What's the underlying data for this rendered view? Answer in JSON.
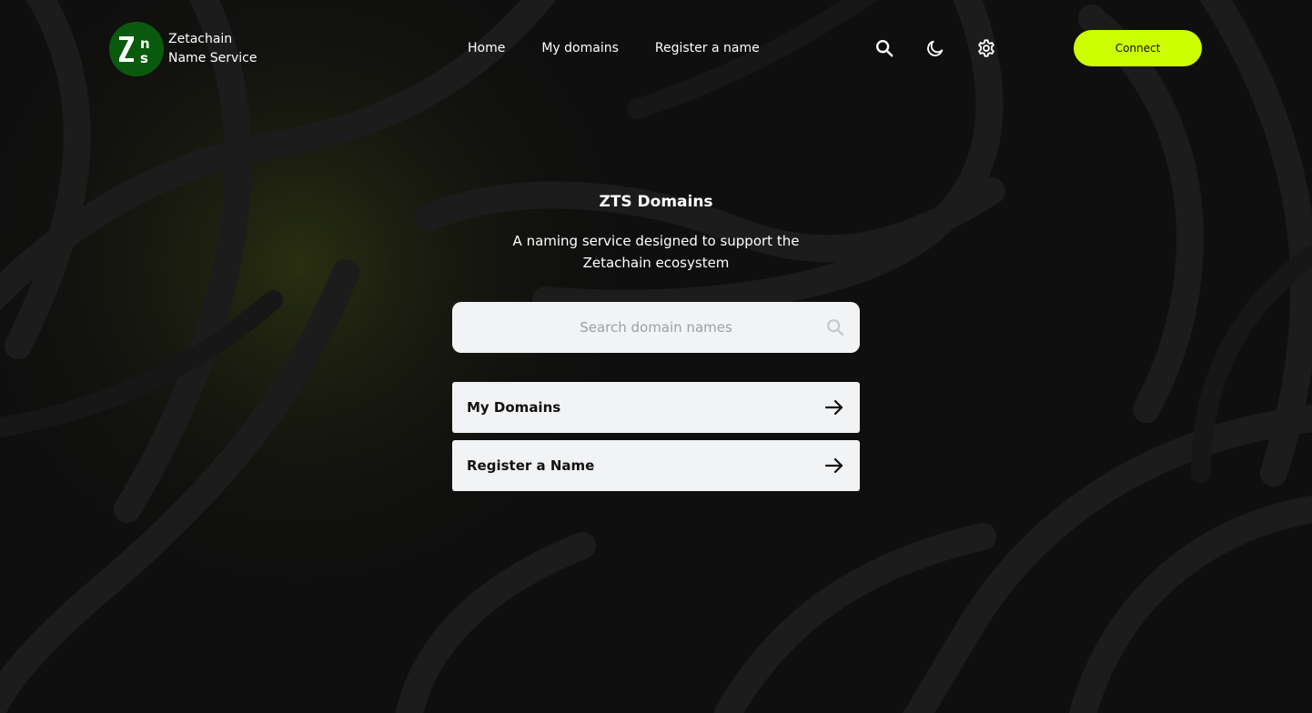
{
  "brand": {
    "name_line1": "Zetachain",
    "name_line2": "Name Service",
    "logo_icon": "zns-logo-icon",
    "logo_color": "#0a5a0d"
  },
  "nav": {
    "home": "Home",
    "my_domains": "My domains",
    "register": "Register a name"
  },
  "header_icons": [
    "search-icon",
    "moon-icon",
    "gear-icon"
  ],
  "connect_label": "Connect",
  "accent_color": "#ccff00",
  "hero": {
    "title": "ZTS Domains",
    "subtitle": "A naming service designed to support the Zetachain ecosystem"
  },
  "search": {
    "placeholder": "Search domain names",
    "value": ""
  },
  "cards": {
    "my_domains": "My Domains",
    "register": "Register a Name"
  }
}
